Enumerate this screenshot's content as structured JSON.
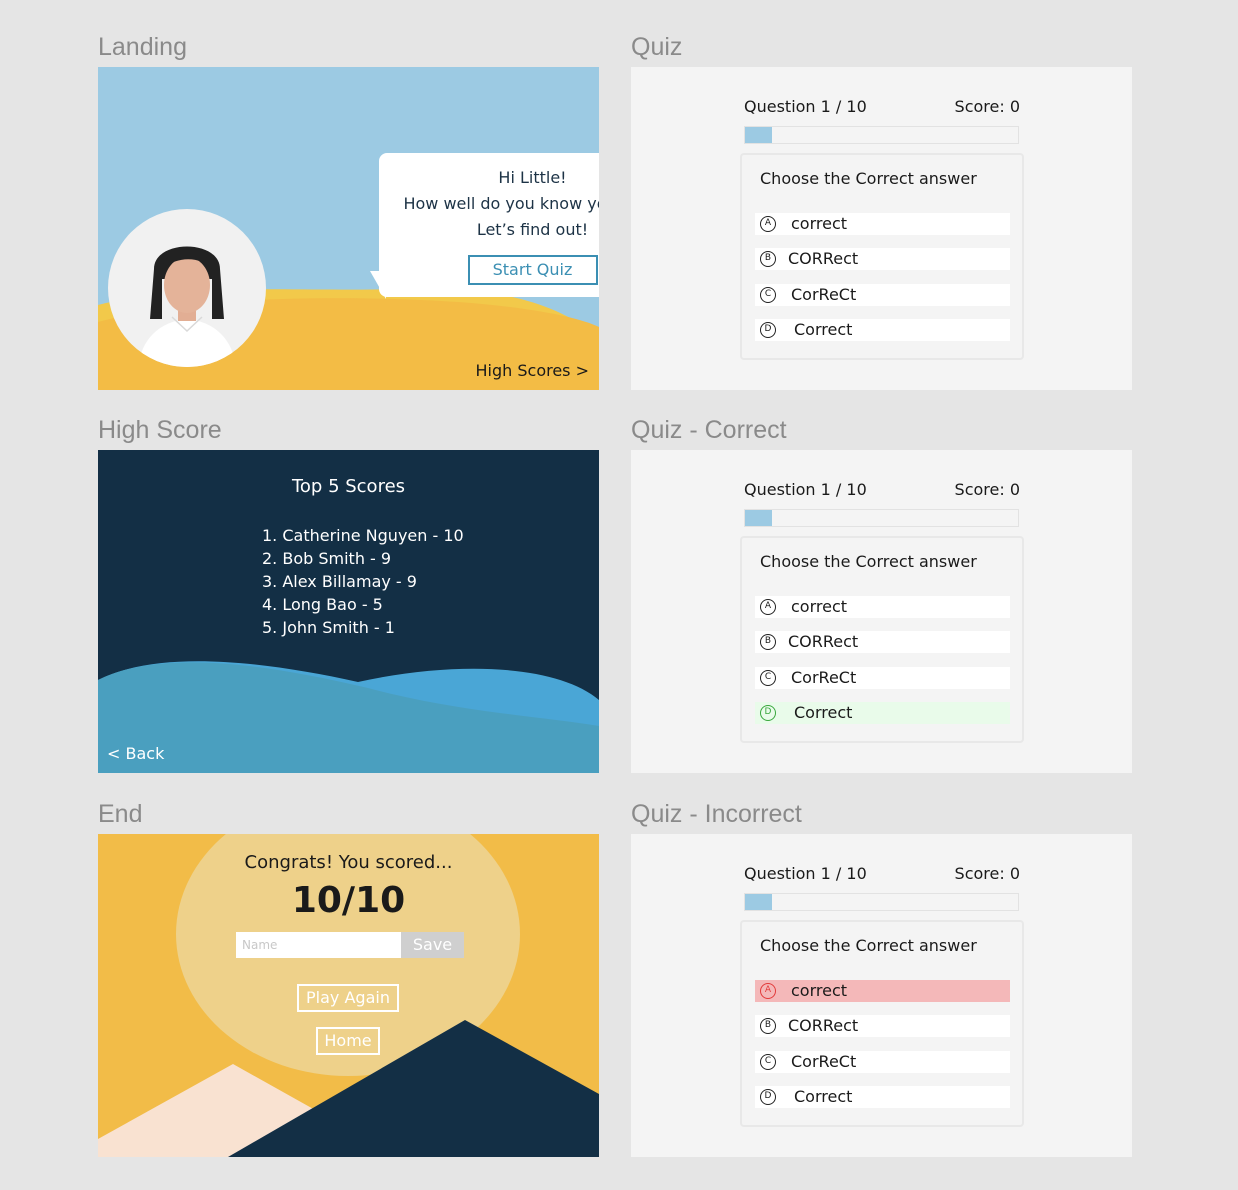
{
  "frames": {
    "landing": "Landing",
    "quiz": "Quiz",
    "high_score": "High Score",
    "quiz_correct": "Quiz - Correct",
    "end": "End",
    "quiz_incorrect": "Quiz - Incorrect"
  },
  "landing": {
    "greeting_line1": "Hi Little!",
    "greeting_line2": "How well do you know your big?",
    "greeting_line3": "Let’s find out!",
    "start_button": "Start Quiz",
    "high_scores_link": "High Scores >"
  },
  "quiz": {
    "question_counter": "Question 1 / 10",
    "score": "Score: 0",
    "progress_fraction": 0.1,
    "prompt": "Choose the Correct answer",
    "options": [
      {
        "letter": "A",
        "text": "correct"
      },
      {
        "letter": "B",
        "text": "CORRect"
      },
      {
        "letter": "C",
        "text": "CorReCt"
      },
      {
        "letter": "D",
        "text": "Correct"
      }
    ],
    "correct_state_highlight": "D",
    "incorrect_state_highlight": "A"
  },
  "high_score": {
    "title": "Top 5 Scores",
    "entries": [
      "1. Catherine Nguyen - 10",
      "2. Bob Smith - 9",
      "3. Alex Billamay - 9",
      "4. Long Bao - 5",
      "5. John Smith - 1"
    ],
    "back_link": "< Back"
  },
  "end": {
    "congrats": "Congrats! You scored...",
    "score": "10/10",
    "name_placeholder": "Name",
    "save_button": "Save",
    "play_again_button": "Play Again",
    "home_button": "Home"
  },
  "colors": {
    "sky": "#9ccae3",
    "sand": "#f2bc48",
    "navy": "#132f45",
    "accent_blue": "#3b8fb3",
    "correct_bg": "#e9fbea",
    "incorrect_bg": "#f4b8b9"
  }
}
